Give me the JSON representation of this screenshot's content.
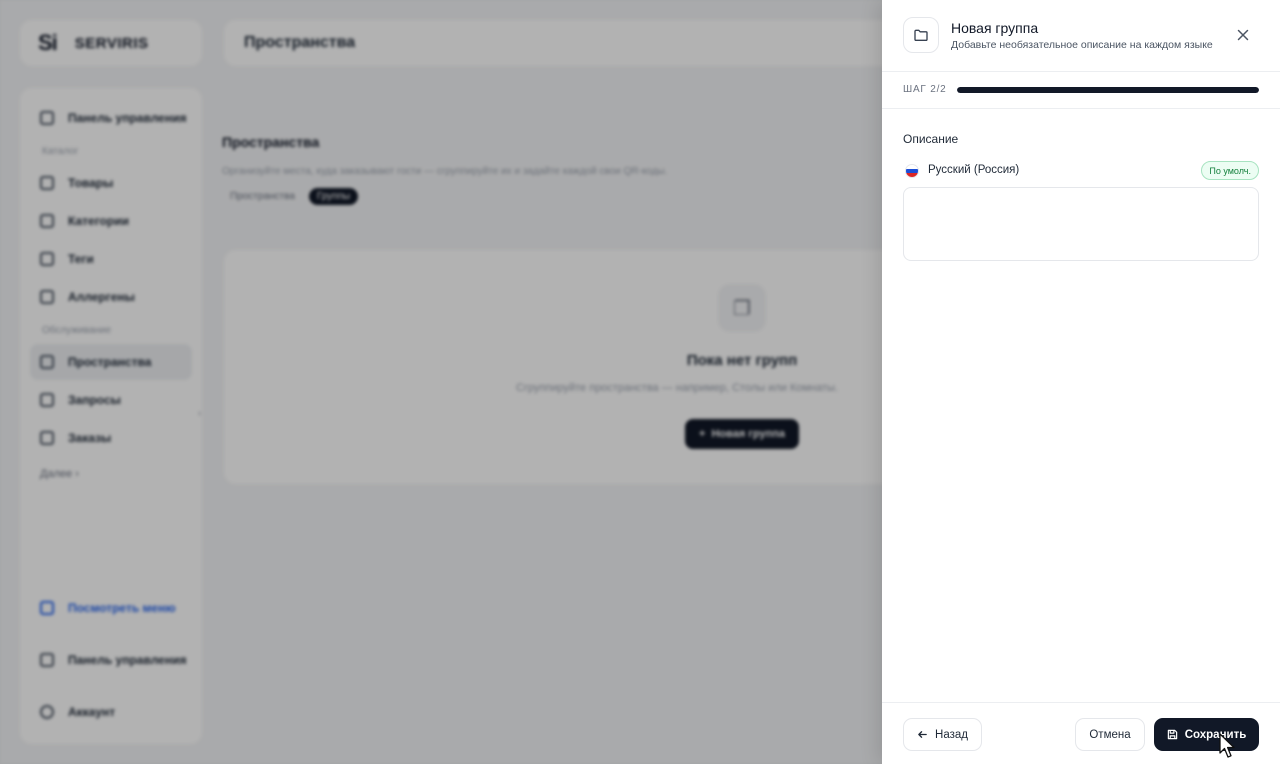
{
  "app": {
    "logo_mark": "Si",
    "logo_text": "SERVIRIS",
    "page_title": "Пространства"
  },
  "sidebar": {
    "items": [
      {
        "label": "Панель управления",
        "icon": "dashboard-icon"
      },
      {
        "section": "Каталог"
      },
      {
        "label": "Товары",
        "icon": "box-icon"
      },
      {
        "label": "Категории",
        "icon": "grid-icon"
      },
      {
        "label": "Теги",
        "icon": "tag-icon"
      },
      {
        "label": "Аллергены",
        "icon": "allergen-icon"
      },
      {
        "section": "Обслуживание"
      },
      {
        "label": "Пространства",
        "icon": "map-pin-icon",
        "active": true
      },
      {
        "label": "Запросы",
        "icon": "bell-icon"
      },
      {
        "label": "Заказы",
        "icon": "receipt-icon"
      }
    ],
    "more_label": "Далее",
    "bottom_items": [
      {
        "label": "Посмотреть меню",
        "icon": "external-link-icon"
      },
      {
        "label": "Панель управления",
        "icon": "dashboard-icon"
      },
      {
        "label": "Аккаунт",
        "icon": "user-icon"
      }
    ]
  },
  "main": {
    "title": "Пространства",
    "subtitle": "Организуйте места, куда заказывают гости — сгруппируйте их и задайте каждой свои QR-коды.",
    "tabs": [
      {
        "label": "Пространства",
        "active": false
      },
      {
        "label": "Группы",
        "active": true
      }
    ],
    "empty": {
      "title": "Пока нет групп",
      "subtitle": "Сгруппируйте пространства — например, Столы или Комнаты.",
      "button_label": "Новая группа",
      "button_icon": "plus-icon"
    }
  },
  "drawer": {
    "icon": "folder-icon",
    "title": "Новая группа",
    "subtitle": "Добавьте необязательное описание на каждом языке",
    "step_label": "ШАГ 2/2",
    "progress": 1.0,
    "field_label": "Описание",
    "language": {
      "name": "Русский (Россия)",
      "flag_colors": [
        "#ffffff",
        "#1c4ed8",
        "#dc2626"
      ],
      "default_badge": "По умолч."
    },
    "description_value": "",
    "footer": {
      "back_label": "Назад",
      "cancel_label": "Отмена",
      "save_label": "Сохранить"
    }
  },
  "colors": {
    "primary": "#111827",
    "badge_green": "#15803d",
    "link_blue": "#2563eb"
  }
}
